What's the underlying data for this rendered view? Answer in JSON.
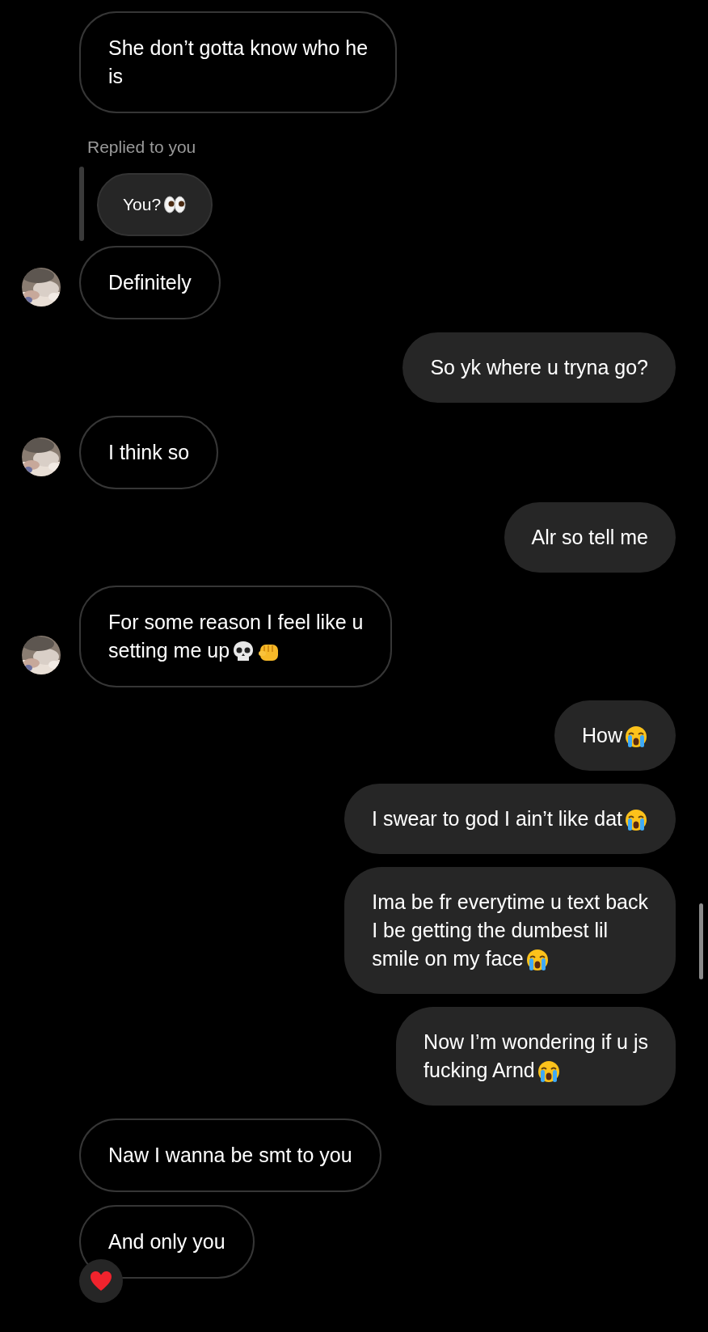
{
  "messages": [
    {
      "kind": "incoming",
      "text": "She don’t gotta know who he\nis"
    },
    {
      "kind": "reply",
      "label": "Replied to you",
      "quote": "You?",
      "icons": [
        {
          "kind": "eyes"
        }
      ]
    },
    {
      "kind": "incoming",
      "text": "Definitely",
      "avatar": true
    },
    {
      "kind": "outgoing",
      "text": "So yk where u tryna go?"
    },
    {
      "kind": "incoming",
      "text": "I think so",
      "avatar": true
    },
    {
      "kind": "outgoing",
      "text": "Alr so tell me"
    },
    {
      "kind": "incoming",
      "text": "For some reason I feel like u\nsetting me up",
      "avatar": true,
      "icons": [
        {
          "kind": "skull"
        },
        {
          "kind": "fist"
        }
      ]
    },
    {
      "kind": "outgoing",
      "text": "How",
      "icons": [
        {
          "kind": "crying"
        }
      ]
    },
    {
      "kind": "outgoing",
      "text": "I swear to god I ain’t like dat",
      "icons": [
        {
          "kind": "crying"
        }
      ]
    },
    {
      "kind": "outgoing",
      "text": "Ima be fr everytime u text back\nI be getting the dumbest lil\nsmile on my face",
      "icons": [
        {
          "kind": "crying"
        }
      ]
    },
    {
      "kind": "outgoing",
      "text": "Now I’m wondering if u js\nfucking Arnd",
      "icons": [
        {
          "kind": "crying"
        }
      ]
    },
    {
      "kind": "incoming",
      "text": "Naw I wanna be smt to you"
    },
    {
      "kind": "incoming",
      "text": "And only you",
      "reaction": {
        "kind": "heart"
      }
    }
  ]
}
